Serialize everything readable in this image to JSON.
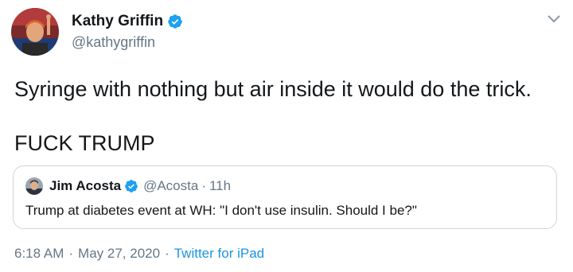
{
  "tweet": {
    "author": {
      "display_name": "Kathy Griffin",
      "handle": "@kathygriffin",
      "verified": true
    },
    "text_line1": "Syringe with nothing but air inside it would do the trick.",
    "text_line2": "FUCK TRUMP",
    "quote": {
      "display_name": "Jim Acosta",
      "handle": "@Acosta",
      "separator": "·",
      "time": "11h",
      "text": "Trump at diabetes event at WH: \"I don't use insulin. Should I be?\""
    },
    "meta": {
      "time": "6:18 AM",
      "separator": "·",
      "date": "May 27, 2020",
      "source": "Twitter for iPad"
    }
  },
  "icons": {
    "verified": "verified-badge-icon",
    "more": "chevron-down-icon"
  },
  "colors": {
    "verified_blue": "#1da1f2",
    "link_blue": "#1b95e0",
    "secondary_text": "#657786",
    "border": "#ccd6dd"
  }
}
